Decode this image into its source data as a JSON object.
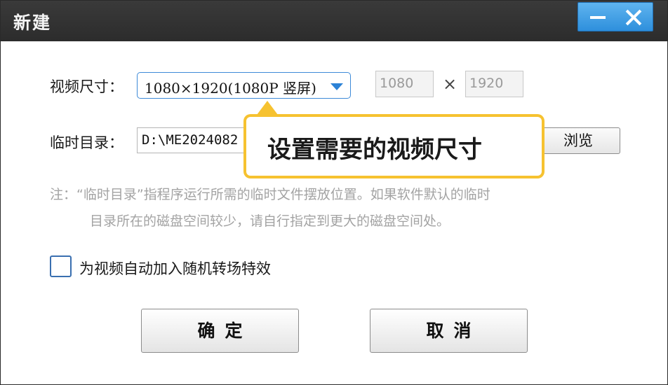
{
  "window": {
    "title": "新建",
    "minimize_icon": "minimize-icon",
    "close_icon": "close-icon"
  },
  "video_size": {
    "label": "视频尺寸：",
    "selected": "1080×1920(1080P 竖屏)",
    "width": "1080",
    "times": "×",
    "height": "1920"
  },
  "temp_dir": {
    "label": "临时目录：",
    "value": "D:\\ME2024082",
    "browse_label": "浏览"
  },
  "callout": {
    "text": "设置需要的视频尺寸"
  },
  "note": {
    "line1": "注：“临时目录”指程序运行所需的临时文件摆放位置。如果软件默认的临时",
    "line2": "目录所在的磁盘空间较少，请自行指定到更大的磁盘空间处。"
  },
  "transition": {
    "label": "为视频自动加入随机转场特效",
    "checked": false
  },
  "actions": {
    "ok_label": "确定",
    "cancel_label": "取消"
  },
  "colors": {
    "title_bar": "#2c2c2c",
    "window_buttons": "#2e8fdc",
    "callout_border": "#f6c230",
    "select_border": "#3d8ad8",
    "note_text": "#a3a3a3"
  }
}
